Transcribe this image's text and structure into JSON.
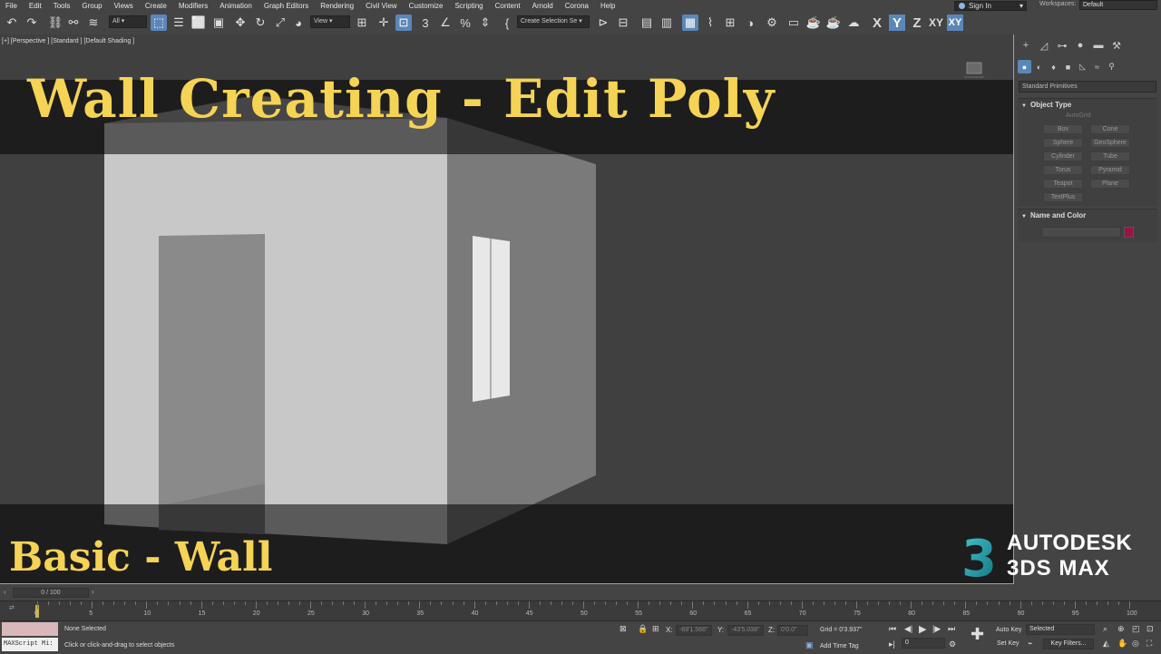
{
  "menu": [
    "File",
    "Edit",
    "Tools",
    "Group",
    "Views",
    "Create",
    "Modifiers",
    "Animation",
    "Graph Editors",
    "Rendering",
    "Civil View",
    "Customize",
    "Scripting",
    "Content",
    "Arnold",
    "Corona",
    "Help"
  ],
  "account": {
    "sign_in": "Sign In",
    "workspaces_label": "Workspaces:",
    "workspace": "Default"
  },
  "toolbar": {
    "filter": "All",
    "ref_coord": "View",
    "selection_set": "Create Selection Se",
    "axes": {
      "x": "X",
      "y": "Y",
      "z": "Z",
      "xy": "XY"
    }
  },
  "viewport": {
    "label": "[+] [Perspective ] [Standard ] [Default Shading ]",
    "title": "Wall Creating - Edit Poly",
    "subtitle": "Basic - Wall"
  },
  "panel": {
    "category_dropdown": "Standard Primitives",
    "object_type": {
      "header": "Object Type",
      "autogrid": "AutoGrid",
      "buttons": [
        "Box",
        "Cone",
        "Sphere",
        "GeoSphere",
        "Cylinder",
        "Tube",
        "Torus",
        "Pyramid",
        "Teapot",
        "Plane",
        "TextPlus"
      ]
    },
    "name_color": {
      "header": "Name and Color",
      "color": "#9b1346"
    }
  },
  "logo": {
    "line1": "AUTODESK",
    "line2": "3DS MAX",
    "mark": "3"
  },
  "timeline": {
    "frame_display": "0 / 100",
    "current_frame": 0,
    "ticks": [
      "0",
      "5",
      "10",
      "15",
      "20",
      "25",
      "30",
      "35",
      "40",
      "45",
      "50",
      "55",
      "60",
      "65",
      "70",
      "75",
      "80",
      "85",
      "90",
      "95",
      "100"
    ]
  },
  "status": {
    "maxscript": "MAXScript Mi:",
    "selection": "None Selected",
    "prompt": "Click or click-and-drag to select objects",
    "x_label": "X:",
    "x_value": "-69'1.566\"",
    "y_label": "Y:",
    "y_value": "-43'5.038\"",
    "z_label": "Z:",
    "z_value": "0'0.0\"",
    "grid": "Grid = 0'3.937\"",
    "add_time_tag": "Add Time Tag",
    "auto_key": "Auto Key",
    "set_key": "Set Key",
    "key_mode": "Selected",
    "key_filters": "Key Filters...",
    "frame_field": "0"
  }
}
